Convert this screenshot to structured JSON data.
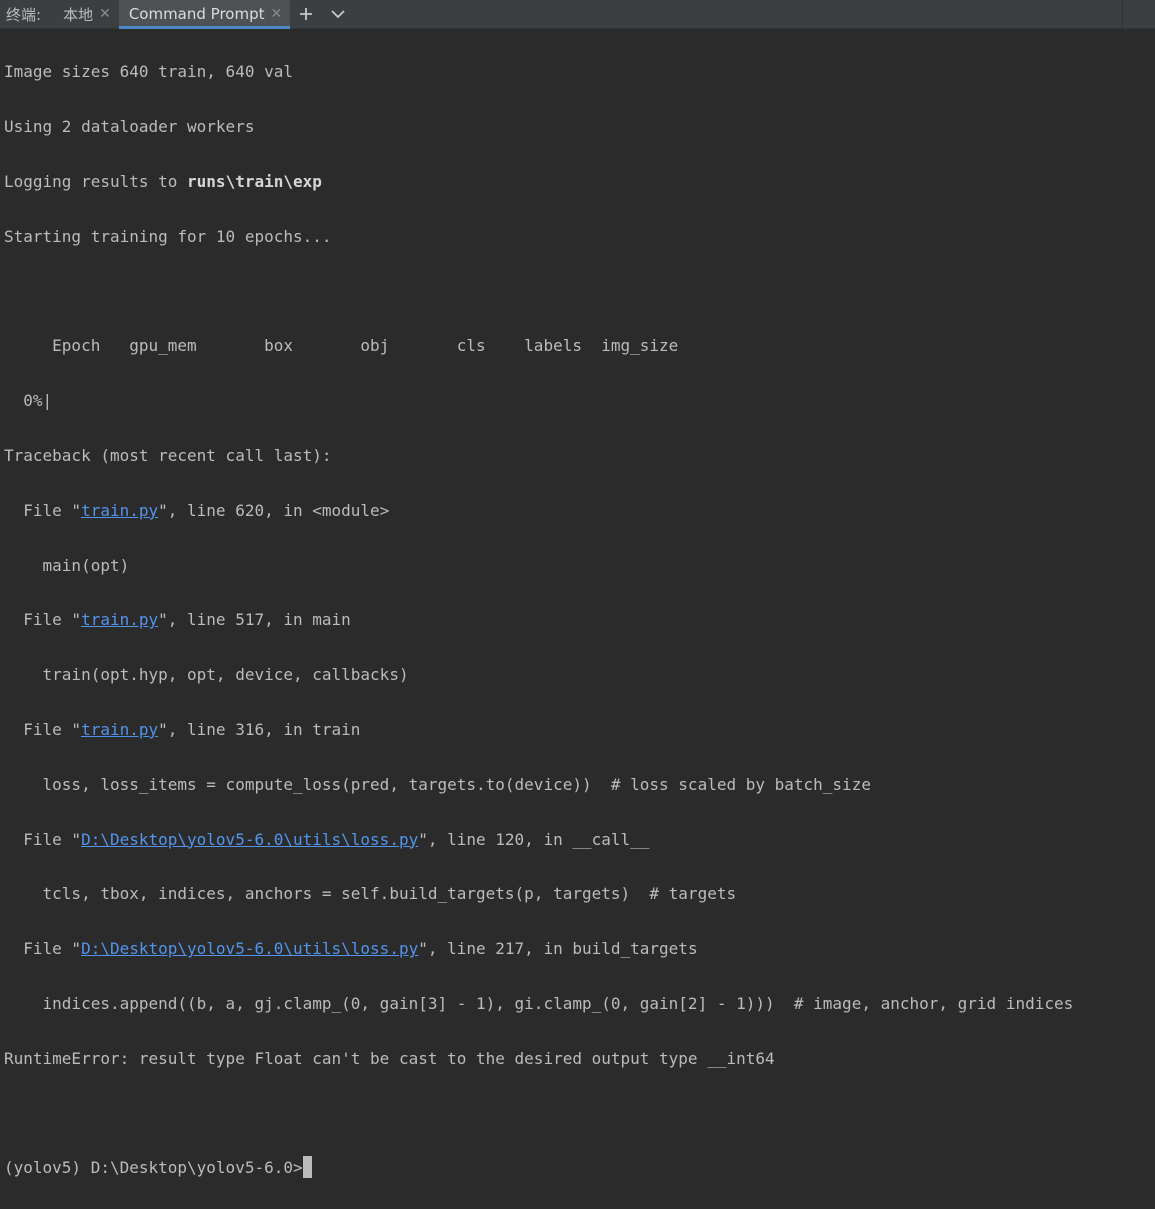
{
  "tabbar": {
    "label": "终端:",
    "tabs": [
      {
        "label": "本地",
        "active": false
      },
      {
        "label": "Command Prompt",
        "active": true
      }
    ],
    "add_icon": "plus-icon",
    "menu_icon": "chevron-down-icon"
  },
  "terminal": {
    "l1": "Image sizes 640 train, 640 val",
    "l2": "Using 2 dataloader workers",
    "l3_pre": "Logging results to ",
    "l3_bold": "runs\\train\\exp",
    "l4": "Starting training for 10 epochs...",
    "header": "     Epoch   gpu_mem       box       obj       cls    labels  img_size",
    "progress": "  0%|",
    "traceback": "Traceback (most recent call last):",
    "frames": [
      {
        "pre": "  File \"",
        "file": "train.py",
        "post": "\", line 620, in <module>",
        "code": "    main(opt)"
      },
      {
        "pre": "  File \"",
        "file": "train.py",
        "post": "\", line 517, in main",
        "code": "    train(opt.hyp, opt, device, callbacks)"
      },
      {
        "pre": "  File \"",
        "file": "train.py",
        "post": "\", line 316, in train",
        "code": "    loss, loss_items = compute_loss(pred, targets.to(device))  # loss scaled by batch_size"
      },
      {
        "pre": "  File \"",
        "file": "D:\\Desktop\\yolov5-6.0\\utils\\loss.py",
        "post": "\", line 120, in __call__",
        "code": "    tcls, tbox, indices, anchors = self.build_targets(p, targets)  # targets"
      },
      {
        "pre": "  File \"",
        "file": "D:\\Desktop\\yolov5-6.0\\utils\\loss.py",
        "post": "\", line 217, in build_targets",
        "code": "    indices.append((b, a, gj.clamp_(0, gain[3] - 1), gi.clamp_(0, gain[2] - 1)))  # image, anchor, grid indices"
      }
    ],
    "error": "RuntimeError: result type Float can't be cast to the desired output type __int64",
    "prompt": "(yolov5) D:\\Desktop\\yolov5-6.0>"
  }
}
